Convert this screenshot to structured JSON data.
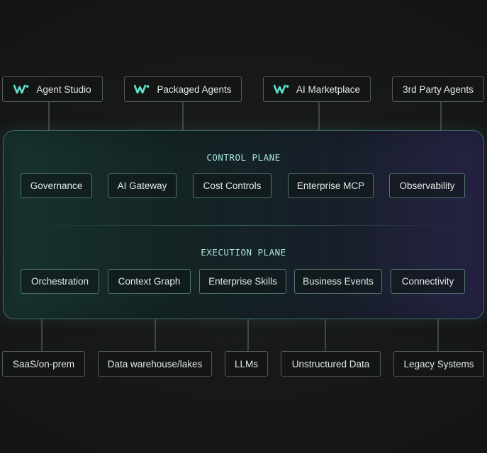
{
  "top_sources": [
    {
      "label": "Agent Studio",
      "icon": "w-logo-icon"
    },
    {
      "label": "Packaged Agents",
      "icon": "w-logo-icon"
    },
    {
      "label": "AI Marketplace",
      "icon": "w-logo-icon"
    },
    {
      "label": "3rd Party Agents",
      "icon": ""
    }
  ],
  "control_plane": {
    "title": "CONTROL PLANE",
    "items": [
      "Governance",
      "AI Gateway",
      "Cost Controls",
      "Enterprise MCP",
      "Observability"
    ]
  },
  "execution_plane": {
    "title": "EXECUTION PLANE",
    "items": [
      "Orchestration",
      "Context Graph",
      "Enterprise Skills",
      "Business Events",
      "Connectivity"
    ]
  },
  "bottom_targets": [
    "SaaS/on-prem",
    "Data warehouse/lakes",
    "LLMs",
    "Unstructured Data",
    "Legacy Systems"
  ],
  "colors": {
    "logo": "#5fe3cf",
    "plane_title": "#a9e6dd",
    "connector": "#4f5756"
  }
}
